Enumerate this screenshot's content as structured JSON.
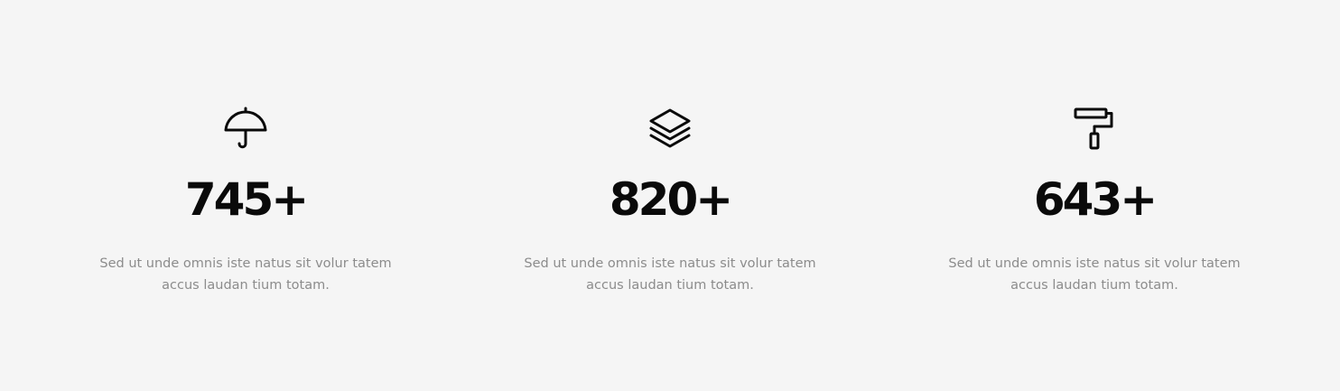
{
  "stats": [
    {
      "icon": "umbrella-icon",
      "number": "745+",
      "description": "Sed ut unde omnis iste natus sit volur tatem accus laudan tium totam."
    },
    {
      "icon": "layers-icon",
      "number": "820+",
      "description": "Sed ut unde omnis iste natus sit volur tatem accus laudan tium totam."
    },
    {
      "icon": "paint-roller-icon",
      "number": "643+",
      "description": "Sed ut unde omnis iste natus sit volur tatem accus laudan tium totam."
    }
  ]
}
